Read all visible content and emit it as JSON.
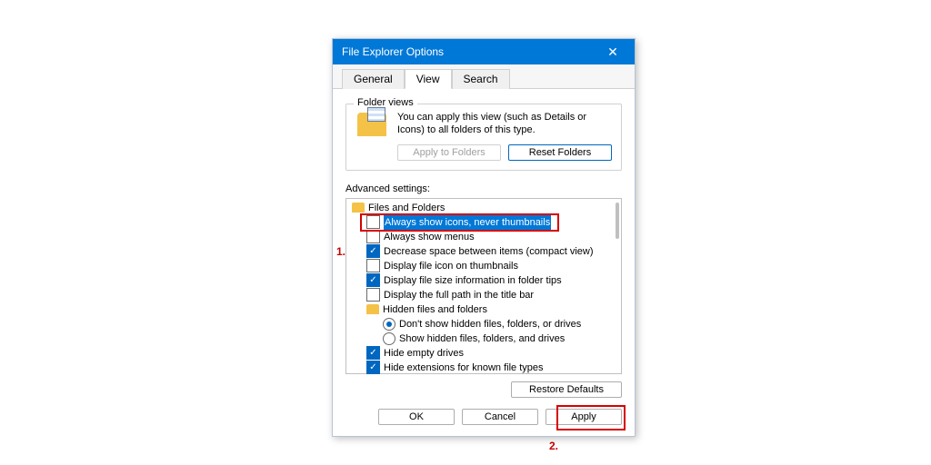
{
  "window": {
    "title": "File Explorer Options"
  },
  "tabs": {
    "general": "General",
    "view": "View",
    "search": "Search"
  },
  "folder_views": {
    "title": "Folder views",
    "help": "You can apply this view (such as Details or Icons) to all folders of this type.",
    "apply_btn": "Apply to Folders",
    "reset_btn": "Reset Folders"
  },
  "settings_label": "Advanced settings:",
  "tree": {
    "files_folders": "Files and Folders",
    "opt_always_icons": "Always show icons, never thumbnails",
    "opt_always_menus": "Always show menus",
    "opt_compact": "Decrease space between items (compact view)",
    "opt_icon_thumb": "Display file icon on thumbnails",
    "opt_size_tips": "Display file size information in folder tips",
    "opt_full_path": "Display the full path in the title bar",
    "hidden": "Hidden files and folders",
    "rad_hide": "Don't show hidden files, folders, or drives",
    "rad_show": "Show hidden files, folders, and drives",
    "opt_hide_empty": "Hide empty drives",
    "opt_hide_ext": "Hide extensions for known file types"
  },
  "buttons": {
    "restore": "Restore Defaults",
    "ok": "OK",
    "cancel": "Cancel",
    "apply": "Apply"
  },
  "annotations": {
    "one": "1.",
    "two": "2."
  }
}
